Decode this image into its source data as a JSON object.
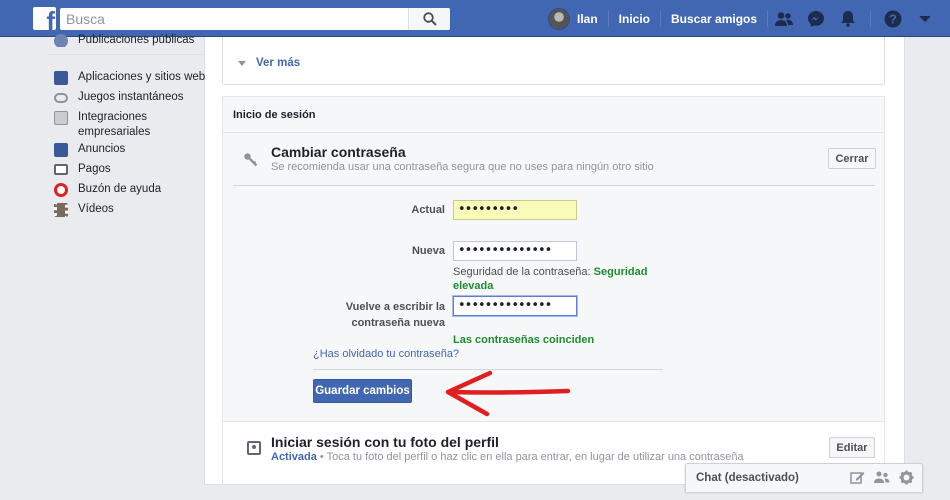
{
  "topbar": {
    "logo_letter": "f",
    "search_placeholder": "Busca",
    "user_name": "Ilan",
    "home_label": "Inicio",
    "find_friends_label": "Buscar amigos"
  },
  "sidebar": {
    "items": [
      {
        "label": "Publicaciones públicas",
        "icon": "globe-icon",
        "color": "#6d84b4"
      },
      {
        "label": "Aplicaciones y sitios web",
        "icon": "apps-icon",
        "color": "#3b5998"
      },
      {
        "label": "Juegos instantáneos",
        "icon": "gamepad-icon",
        "color": "#8d949e"
      },
      {
        "label": "Integraciones empresariales",
        "icon": "gear-square-icon",
        "color": "#8d949e"
      },
      {
        "label": "Anuncios",
        "icon": "ads-flag-icon",
        "color": "#3b5998"
      },
      {
        "label": "Pagos",
        "icon": "card-icon",
        "color": "#606770"
      },
      {
        "label": "Buzón de ayuda",
        "icon": "lifebuoy-icon",
        "color": "#e02020"
      },
      {
        "label": "Vídeos",
        "icon": "film-icon",
        "color": "#7a6a5a"
      }
    ]
  },
  "top_card": {
    "ver_mas": "Ver más"
  },
  "login_section": {
    "heading": "Inicio de sesión",
    "change_password": {
      "title": "Cambiar contraseña",
      "subtitle": "Se recomienda usar una contraseña segura que no uses para ningún otro sitio",
      "close_label": "Cerrar",
      "current_label": "Actual",
      "current_value": "•••••••••",
      "new_label": "Nueva",
      "new_value": "••••••••••••••",
      "strength_prefix": "Seguridad de la contraseña:",
      "strength_value": "Seguridad elevada",
      "retype_label": "Vuelve a escribir la contraseña nueva",
      "retype_value": "••••••••••••••",
      "match_message": "Las contraseñas coinciden",
      "forgot_link": "¿Has olvidado tu contraseña?",
      "save_label": "Guardar cambios"
    },
    "profile_photo_login": {
      "title": "Iniciar sesión con tu foto del perfil",
      "status": "Activada",
      "description": " • Toca tu foto del perfil o haz clic en ella para entrar, en lugar de utilizar una contraseña",
      "edit_label": "Editar"
    }
  },
  "chat": {
    "label": "Chat (desactivado)"
  },
  "colors": {
    "brand": "#4267b2",
    "success": "#1e8b2e",
    "annotation_arrow": "#e02020"
  }
}
